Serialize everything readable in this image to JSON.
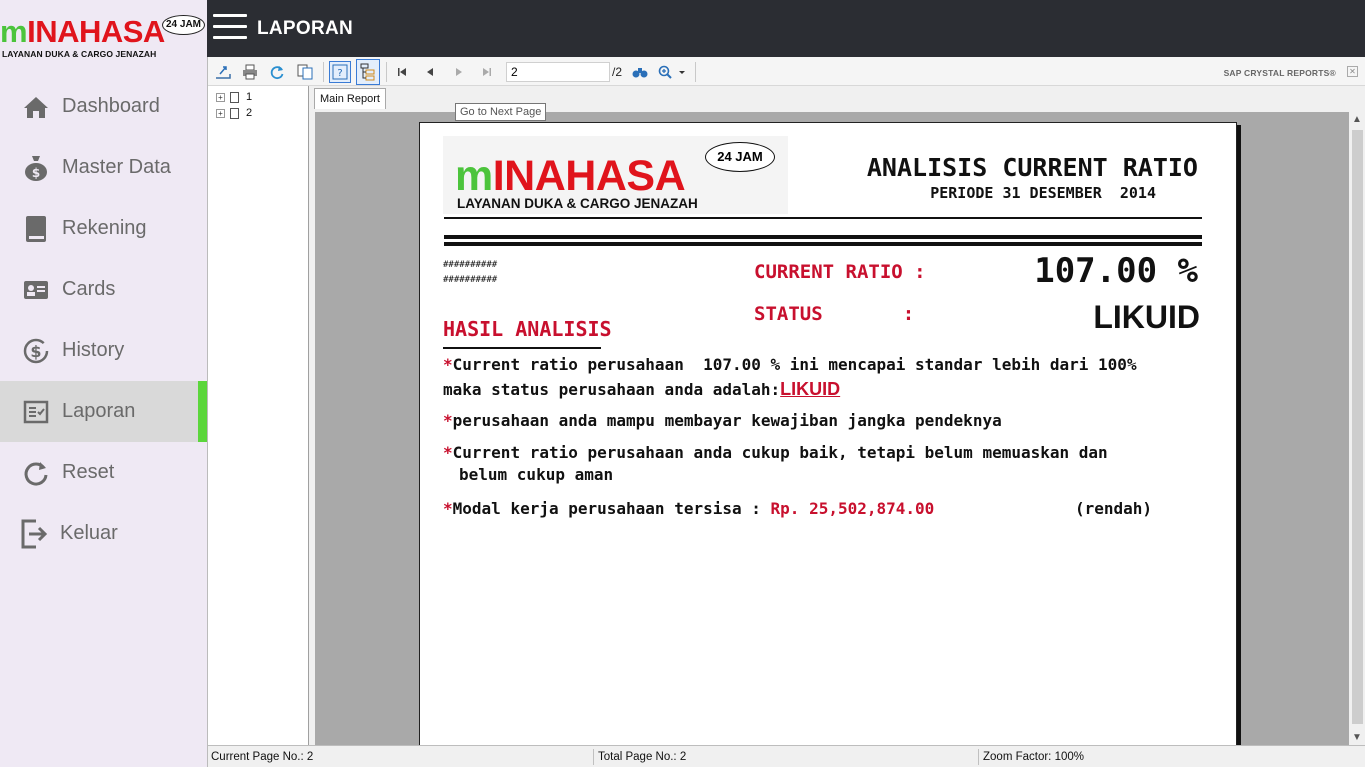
{
  "brand": {
    "logo_m": "m",
    "logo_rest": "INAHASA",
    "badge": "24 JAM",
    "tagline": "LAYANAN DUKA & CARGO JENAZAH"
  },
  "header": {
    "title": "LAPORAN"
  },
  "sidebar": {
    "items": [
      {
        "label": "Dashboard",
        "icon": "home-icon",
        "active": false
      },
      {
        "label": "Master Data",
        "icon": "money-bag-icon",
        "active": false
      },
      {
        "label": "Rekening",
        "icon": "book-icon",
        "active": false
      },
      {
        "label": "Cards",
        "icon": "id-card-icon",
        "active": false
      },
      {
        "label": "History",
        "icon": "dollar-history-icon",
        "active": false
      },
      {
        "label": "Laporan",
        "icon": "report-icon",
        "active": true
      },
      {
        "label": "Reset",
        "icon": "refresh-icon",
        "active": false
      },
      {
        "label": "Keluar",
        "icon": "logout-icon",
        "active": false
      }
    ],
    "accent_color": "#5bd63b"
  },
  "viewer": {
    "page_input": "2",
    "page_total": "/2",
    "sap_label": "SAP CRYSTAL REPORTS®",
    "tab_label": "Main Report",
    "tooltip": "Go to Next Page",
    "tree": [
      "1",
      "2"
    ],
    "status": {
      "current_page": "Current Page No.: 2",
      "total_page": "Total Page No.: 2",
      "zoom": "Zoom Factor: 100%"
    }
  },
  "report": {
    "logo_m": "m",
    "logo_rest": "INAHASA",
    "logo_badge": "24 JAM",
    "logo_tagline": "LAYANAN DUKA & CARGO JENAZAH",
    "title": "ANALISIS CURRENT RATIO",
    "period": "PERIODE 31 DESEMBER  2014",
    "hash1": "##########",
    "hash2": "##########",
    "current_ratio_label": "CURRENT RATIO :",
    "current_ratio_value": "107.00 %",
    "status_label": "STATUS       :",
    "status_value": "LIKUID",
    "hasil_title": "HASIL ANALISIS",
    "p1_a": "Current ratio perusahaan  107.00 % ini mencapai standar lebih dari 100%",
    "p1_b": "maka status perusahaan anda adalah:",
    "p1_link": "LIKUID",
    "p2": "perusahaan anda mampu membayar kewajiban jangka pendeknya",
    "p3_a": "Current ratio perusahaan anda cukup baik, tetapi belum memuaskan dan",
    "p3_b": "belum cukup aman",
    "p4_a": "Modal kerja perusahaan tersisa : ",
    "p4_money": "Rp. 25,502,874.00",
    "p4_note": "(rendah)",
    "accent_red": "#c8102e"
  }
}
